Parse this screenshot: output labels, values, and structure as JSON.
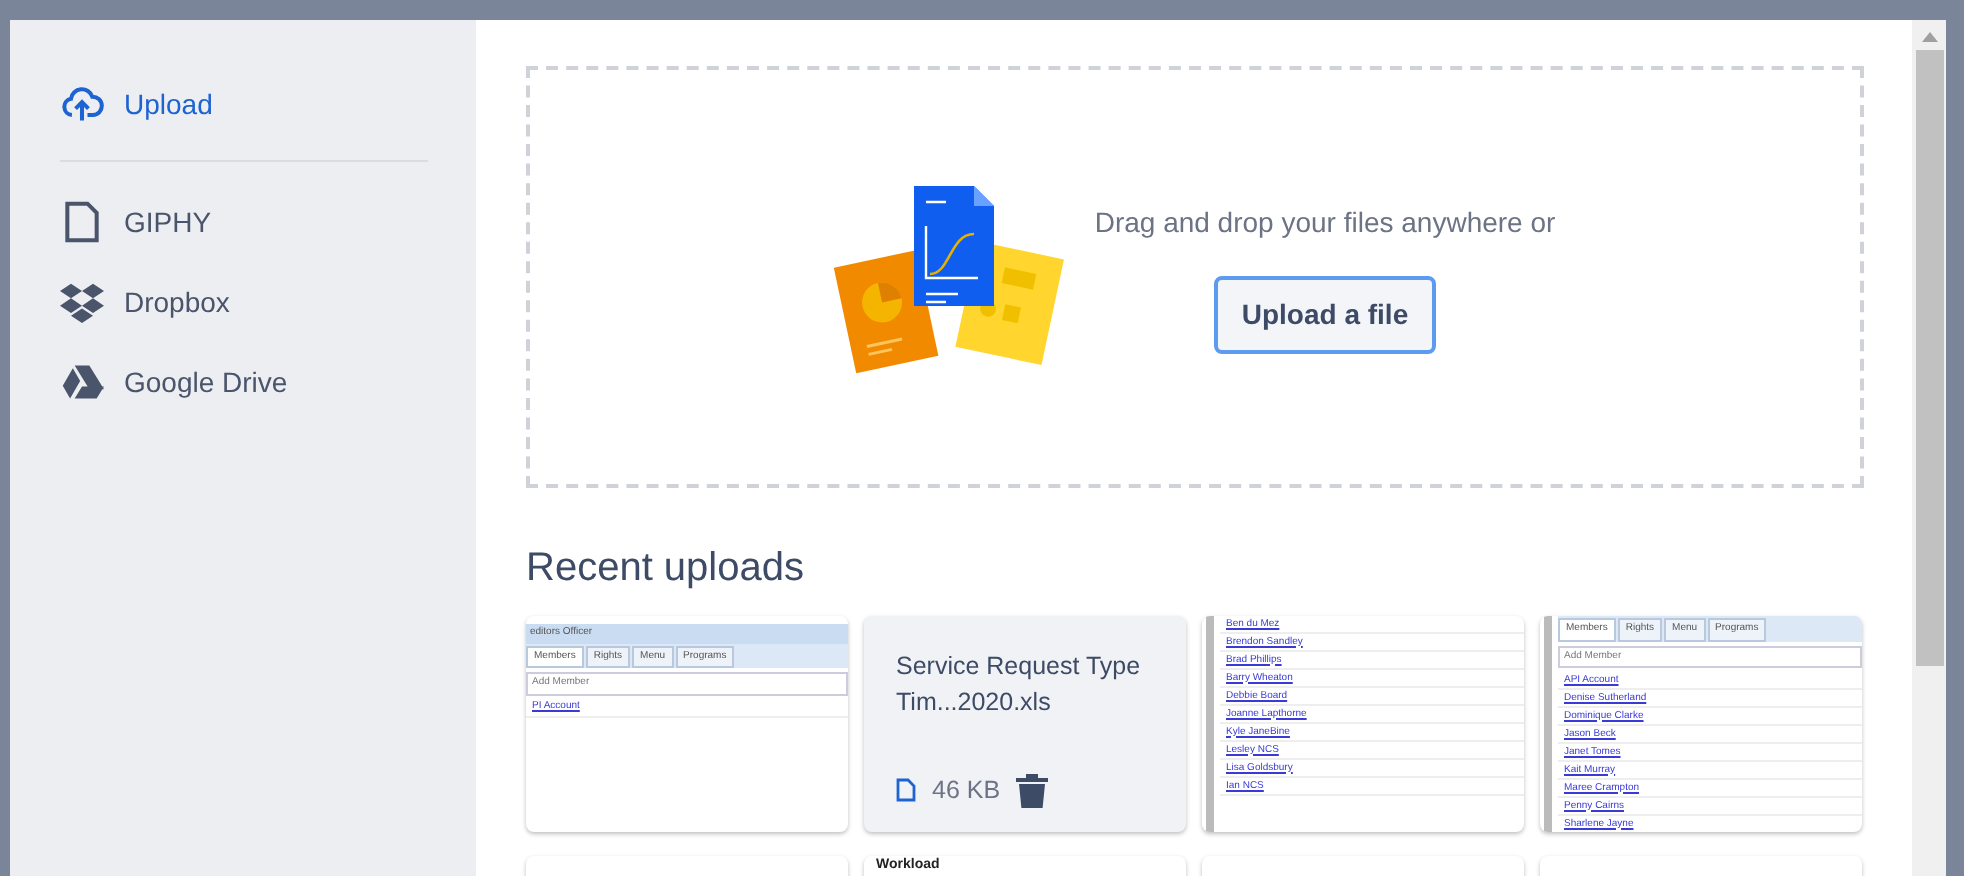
{
  "sidebar": {
    "items": [
      {
        "label": "Upload",
        "selected": true
      },
      {
        "label": "GIPHY",
        "selected": false
      },
      {
        "label": "Dropbox",
        "selected": false
      },
      {
        "label": "Google Drive",
        "selected": false
      }
    ]
  },
  "dropzone": {
    "text": "Drag and drop your files anywhere or",
    "button": "Upload a file"
  },
  "recent": {
    "title": "Recent uploads",
    "cards": [
      {
        "kind": "screenshot",
        "title": "editors Officer",
        "tabs": [
          "Members",
          "Rights",
          "Menu",
          "Programs"
        ],
        "search": "Add Member",
        "links": [
          "PI Account"
        ]
      },
      {
        "kind": "file",
        "name": "Service Request Type Tim...2020.xls",
        "size": "46 KB"
      },
      {
        "kind": "screenshot",
        "scrollbar": true,
        "links": [
          "Ben du Mez",
          "Brendon Sandley",
          "Brad Phillips",
          "Barry Wheaton",
          "Debbie Board",
          "Joanne Lapthorne",
          "Kyle JaneBine",
          "Lesley NCS",
          "Lisa Goldsbury",
          "Ian NCS"
        ]
      },
      {
        "kind": "screenshot",
        "scrollbar": true,
        "tabs": [
          "Members",
          "Rights",
          "Menu",
          "Programs"
        ],
        "search": "Add Member",
        "links": [
          "API Account",
          "Denise Sutherland",
          "Dominique Clarke",
          "Jason Beck",
          "Janet Tomes",
          "Kait Murray",
          "Maree Crampton",
          "Penny Cairns",
          "Sharlene Jayne"
        ]
      },
      {
        "kind": "screenshot"
      },
      {
        "kind": "screenshot",
        "heading": "Workload"
      },
      {
        "kind": "screenshot"
      },
      {
        "kind": "screenshot"
      }
    ]
  }
}
